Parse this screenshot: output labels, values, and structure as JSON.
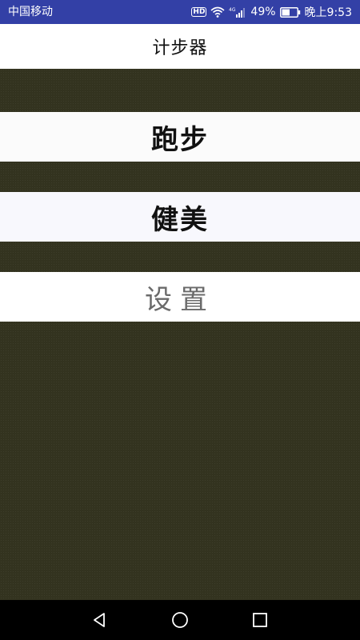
{
  "status_bar": {
    "carrier": "中国移动",
    "hd_badge": "HD",
    "network": "4G",
    "battery_percent": "49%",
    "time": "晚上9:53",
    "icons": [
      "hd-icon",
      "wifi-icon",
      "signal-icon",
      "battery-icon"
    ]
  },
  "app": {
    "title": "计步器"
  },
  "menu": {
    "run_label": "跑步",
    "fitness_label": "健美",
    "settings_label": "设置"
  },
  "nav_bar": {
    "icons": [
      "back-icon",
      "home-icon",
      "recent-apps-icon"
    ]
  },
  "colors": {
    "status_bar": "#3340a6",
    "content_background": "#33331f",
    "title_bar": "#ffffff",
    "nav_bar": "#000000"
  }
}
